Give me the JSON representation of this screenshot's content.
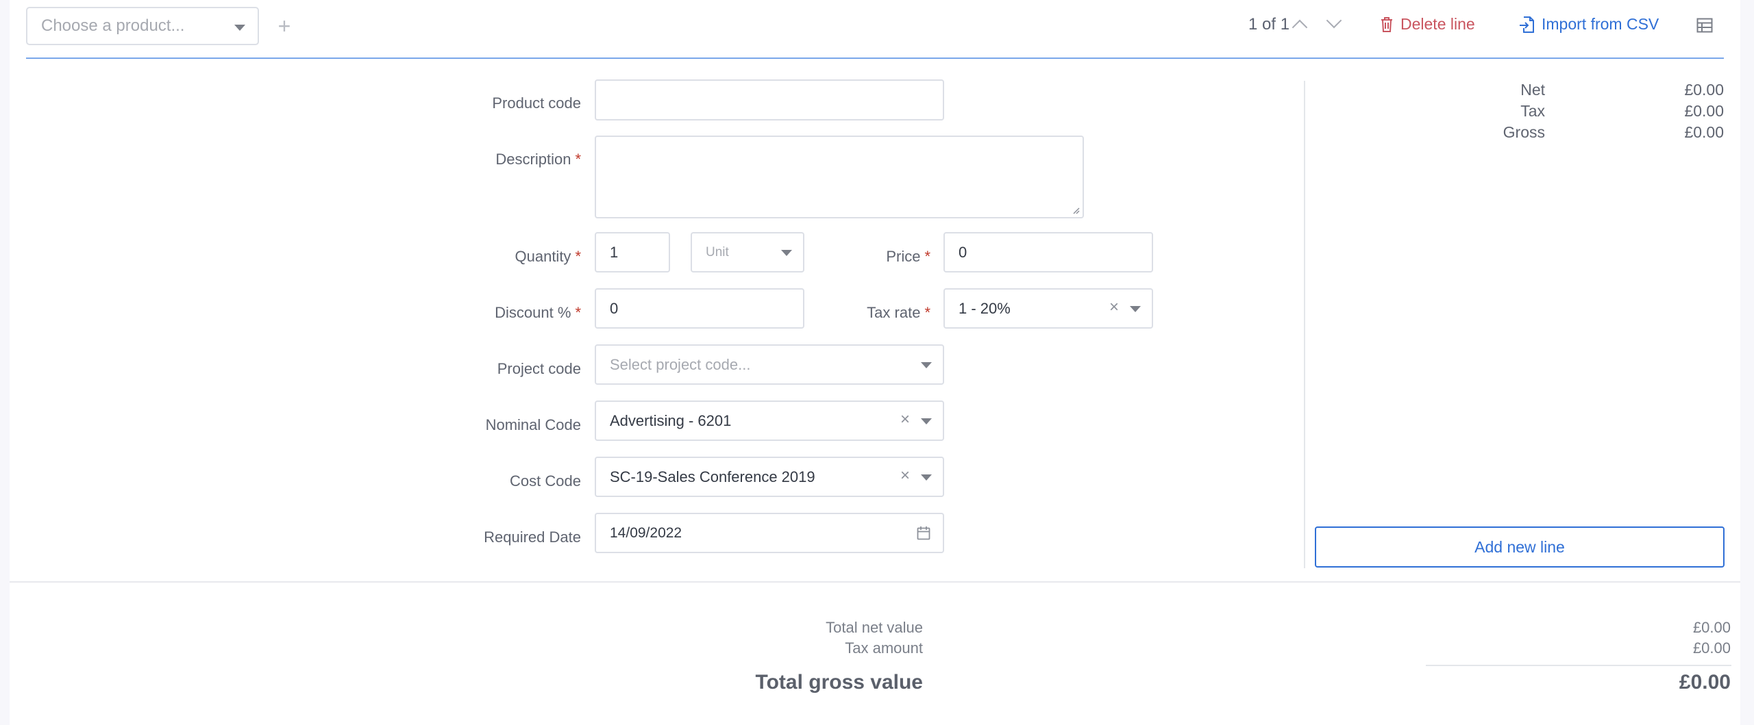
{
  "toolbar": {
    "product_placeholder": "Choose a product...",
    "add_icon": "plus-icon",
    "pager": "1 of 1",
    "delete_label": "Delete line",
    "import_label": "Import from CSV"
  },
  "form": {
    "product_code_label": "Product code",
    "product_code_value": "",
    "description_label": "Description",
    "description_value": "",
    "quantity_label": "Quantity",
    "quantity_value": "1",
    "unit_placeholder": "Unit",
    "price_label": "Price",
    "price_value": "0",
    "discount_label": "Discount %",
    "discount_value": "0",
    "tax_rate_label": "Tax rate",
    "tax_rate_value": "1 - 20%",
    "project_code_label": "Project code",
    "project_code_placeholder": "Select project code...",
    "nominal_code_label": "Nominal Code",
    "nominal_code_value": "Advertising - 6201",
    "cost_code_label": "Cost Code",
    "cost_code_value": "SC-19-Sales Conference 2019",
    "required_date_label": "Required Date",
    "required_date_value": "14/09/2022",
    "required_marker": "*"
  },
  "line_summary": {
    "net_label": "Net",
    "net_value": "£0.00",
    "tax_label": "Tax",
    "tax_value": "£0.00",
    "gross_label": "Gross",
    "gross_value": "£0.00",
    "add_line_label": "Add new line"
  },
  "totals": {
    "net_label": "Total net value",
    "net_value": "£0.00",
    "tax_label": "Tax amount",
    "tax_value": "£0.00",
    "gross_label": "Total gross value",
    "gross_value": "£0.00"
  },
  "colors": {
    "accent": "#2f6fd6",
    "danger": "#c9555f",
    "rule": "#7aa7ea"
  }
}
